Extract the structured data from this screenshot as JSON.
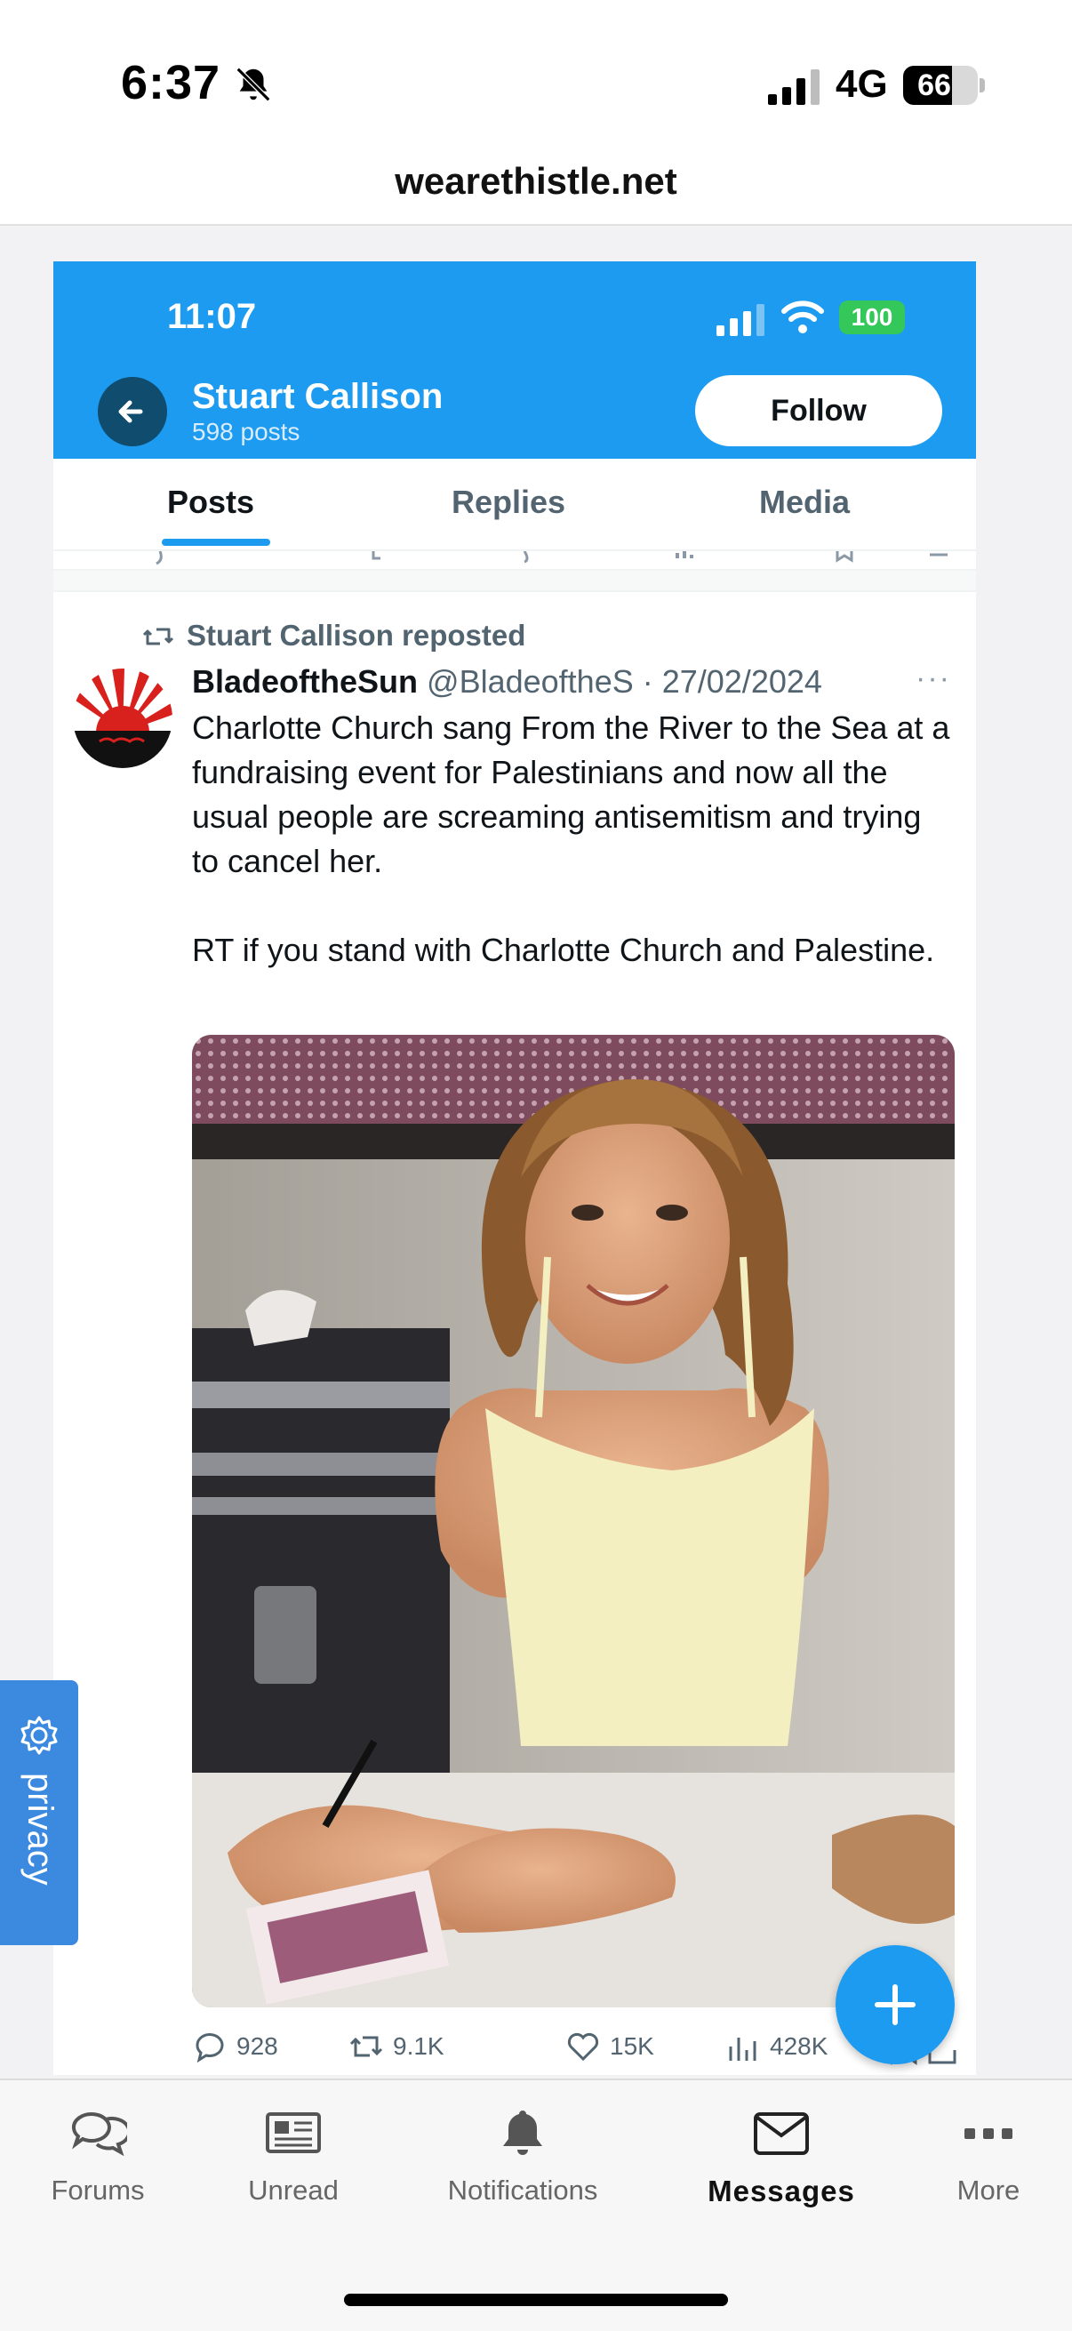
{
  "status_bar": {
    "time": "6:37",
    "network": "4G",
    "battery": "66",
    "battery_level": 0.66
  },
  "browser": {
    "url": "wearethistle.net"
  },
  "embedded": {
    "status_time": "11:07",
    "status_battery": "100",
    "profile": {
      "name": "Stuart Callison",
      "posts": "598 posts",
      "follow_label": "Follow"
    },
    "tabs": [
      {
        "label": "Posts",
        "active": true
      },
      {
        "label": "Replies",
        "active": false
      },
      {
        "label": "Media",
        "active": false
      }
    ],
    "tweet": {
      "repost_label": "Stuart Callison reposted",
      "author": "BladeoftheSun",
      "handle_date": "@BladeoftheS · 27/02/2024",
      "more": "···",
      "text_p1": "Charlotte Church sang From the River to the Sea at a fundraising event for Palestinians and now all the usual people are screaming antisemitism and trying to cancel her.",
      "text_p2": "RT if you stand with Charlotte Church and Palestine.",
      "stats": {
        "replies": "928",
        "reposts": "9.1K",
        "likes": "15K",
        "views": "428K"
      }
    }
  },
  "privacy": {
    "label": "privacy"
  },
  "bottom_nav": [
    {
      "label": "Forums",
      "icon": "forums-icon"
    },
    {
      "label": "Unread",
      "icon": "newspaper-icon"
    },
    {
      "label": "Notifications",
      "icon": "bell-icon"
    },
    {
      "label": "Messages",
      "icon": "envelope-icon",
      "active": true
    },
    {
      "label": "More",
      "icon": "ellipsis-icon"
    }
  ],
  "colors": {
    "twitter_blue": "#1d9bf0",
    "privacy_blue": "#3b8ae0",
    "battery_green": "#34c759"
  }
}
